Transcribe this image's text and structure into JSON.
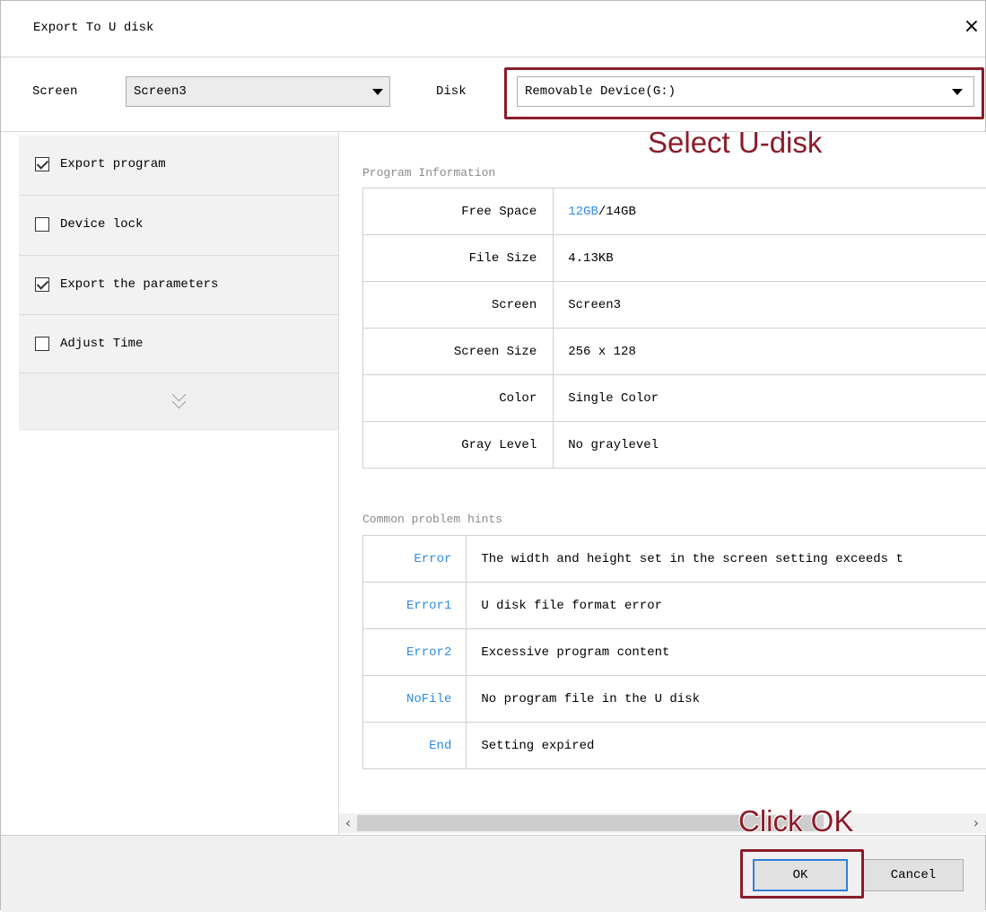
{
  "window": {
    "title": "Export To U disk",
    "close_glyph": "×"
  },
  "toolbar": {
    "screen_label": "Screen",
    "screen_value": "Screen3",
    "disk_label": "Disk",
    "disk_value": "Removable Device(G:)"
  },
  "annotations": {
    "select_udisk": "Select U-disk",
    "click_ok": "Click OK",
    "highlight_color": "#8a1c2a"
  },
  "options": [
    {
      "label": "Export program",
      "checked": true
    },
    {
      "label": "Device lock",
      "checked": false
    },
    {
      "label": "Export the parameters",
      "checked": true
    },
    {
      "label": "Adjust Time",
      "checked": false
    }
  ],
  "program_info": {
    "section_title": "Program Information",
    "rows": [
      {
        "key": "Free Space",
        "free": "12GB",
        "total": "/14GB"
      },
      {
        "key": "File Size",
        "value": "4.13KB"
      },
      {
        "key": "Screen",
        "value": "Screen3"
      },
      {
        "key": "Screen Size",
        "value": "256 x 128"
      },
      {
        "key": "Color",
        "value": "Single Color"
      },
      {
        "key": "Gray Level",
        "value": "No graylevel"
      }
    ]
  },
  "hints": {
    "section_title": "Common problem hints",
    "rows": [
      {
        "code": "Error",
        "text": "The width and height set in the screen setting exceeds t"
      },
      {
        "code": "Error1",
        "text": "U disk file format error"
      },
      {
        "code": "Error2",
        "text": "Excessive program content"
      },
      {
        "code": "NoFile",
        "text": "No program file in the U disk"
      },
      {
        "code": "End",
        "text": "Setting expired"
      }
    ]
  },
  "buttons": {
    "ok": "OK",
    "cancel": "Cancel"
  },
  "colors": {
    "link_blue": "#2f8be6",
    "accent_border": "#2f7fd8"
  }
}
